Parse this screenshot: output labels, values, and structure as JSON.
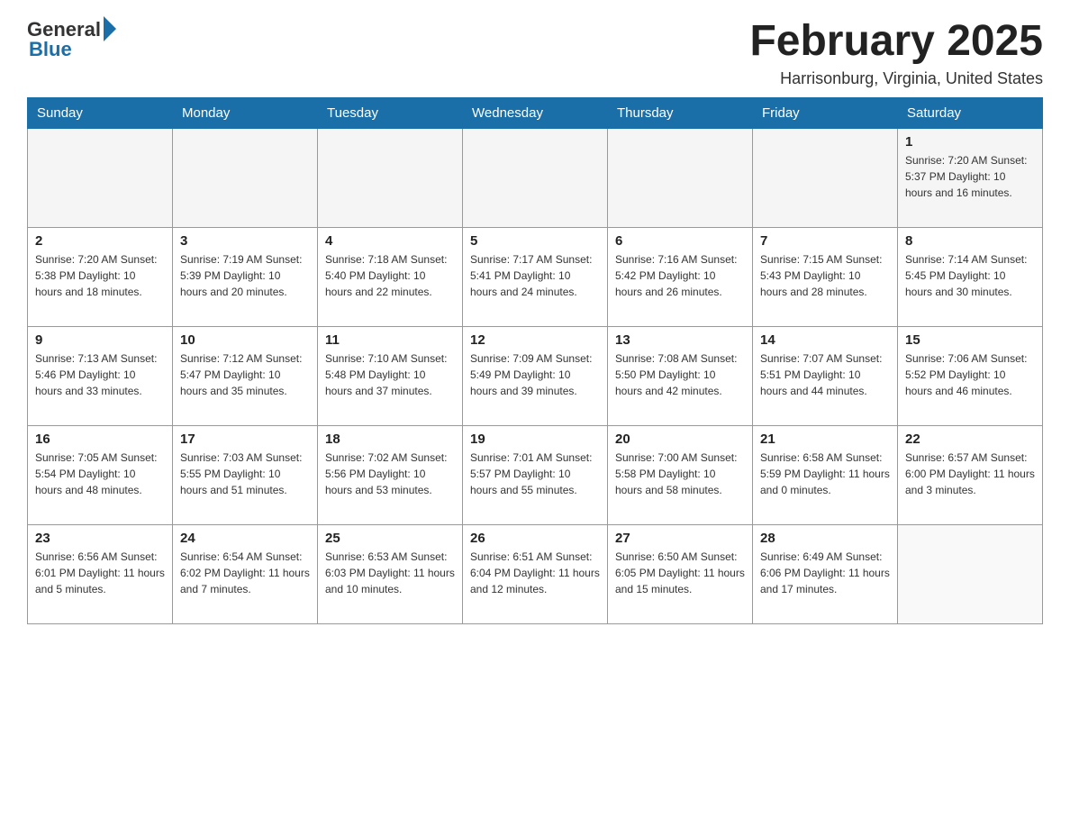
{
  "header": {
    "logo_general": "General",
    "logo_blue": "Blue",
    "month_title": "February 2025",
    "location": "Harrisonburg, Virginia, United States"
  },
  "days_of_week": [
    "Sunday",
    "Monday",
    "Tuesday",
    "Wednesday",
    "Thursday",
    "Friday",
    "Saturday"
  ],
  "weeks": [
    [
      {
        "day": "",
        "info": ""
      },
      {
        "day": "",
        "info": ""
      },
      {
        "day": "",
        "info": ""
      },
      {
        "day": "",
        "info": ""
      },
      {
        "day": "",
        "info": ""
      },
      {
        "day": "",
        "info": ""
      },
      {
        "day": "1",
        "info": "Sunrise: 7:20 AM\nSunset: 5:37 PM\nDaylight: 10 hours and 16 minutes."
      }
    ],
    [
      {
        "day": "2",
        "info": "Sunrise: 7:20 AM\nSunset: 5:38 PM\nDaylight: 10 hours and 18 minutes."
      },
      {
        "day": "3",
        "info": "Sunrise: 7:19 AM\nSunset: 5:39 PM\nDaylight: 10 hours and 20 minutes."
      },
      {
        "day": "4",
        "info": "Sunrise: 7:18 AM\nSunset: 5:40 PM\nDaylight: 10 hours and 22 minutes."
      },
      {
        "day": "5",
        "info": "Sunrise: 7:17 AM\nSunset: 5:41 PM\nDaylight: 10 hours and 24 minutes."
      },
      {
        "day": "6",
        "info": "Sunrise: 7:16 AM\nSunset: 5:42 PM\nDaylight: 10 hours and 26 minutes."
      },
      {
        "day": "7",
        "info": "Sunrise: 7:15 AM\nSunset: 5:43 PM\nDaylight: 10 hours and 28 minutes."
      },
      {
        "day": "8",
        "info": "Sunrise: 7:14 AM\nSunset: 5:45 PM\nDaylight: 10 hours and 30 minutes."
      }
    ],
    [
      {
        "day": "9",
        "info": "Sunrise: 7:13 AM\nSunset: 5:46 PM\nDaylight: 10 hours and 33 minutes."
      },
      {
        "day": "10",
        "info": "Sunrise: 7:12 AM\nSunset: 5:47 PM\nDaylight: 10 hours and 35 minutes."
      },
      {
        "day": "11",
        "info": "Sunrise: 7:10 AM\nSunset: 5:48 PM\nDaylight: 10 hours and 37 minutes."
      },
      {
        "day": "12",
        "info": "Sunrise: 7:09 AM\nSunset: 5:49 PM\nDaylight: 10 hours and 39 minutes."
      },
      {
        "day": "13",
        "info": "Sunrise: 7:08 AM\nSunset: 5:50 PM\nDaylight: 10 hours and 42 minutes."
      },
      {
        "day": "14",
        "info": "Sunrise: 7:07 AM\nSunset: 5:51 PM\nDaylight: 10 hours and 44 minutes."
      },
      {
        "day": "15",
        "info": "Sunrise: 7:06 AM\nSunset: 5:52 PM\nDaylight: 10 hours and 46 minutes."
      }
    ],
    [
      {
        "day": "16",
        "info": "Sunrise: 7:05 AM\nSunset: 5:54 PM\nDaylight: 10 hours and 48 minutes."
      },
      {
        "day": "17",
        "info": "Sunrise: 7:03 AM\nSunset: 5:55 PM\nDaylight: 10 hours and 51 minutes."
      },
      {
        "day": "18",
        "info": "Sunrise: 7:02 AM\nSunset: 5:56 PM\nDaylight: 10 hours and 53 minutes."
      },
      {
        "day": "19",
        "info": "Sunrise: 7:01 AM\nSunset: 5:57 PM\nDaylight: 10 hours and 55 minutes."
      },
      {
        "day": "20",
        "info": "Sunrise: 7:00 AM\nSunset: 5:58 PM\nDaylight: 10 hours and 58 minutes."
      },
      {
        "day": "21",
        "info": "Sunrise: 6:58 AM\nSunset: 5:59 PM\nDaylight: 11 hours and 0 minutes."
      },
      {
        "day": "22",
        "info": "Sunrise: 6:57 AM\nSunset: 6:00 PM\nDaylight: 11 hours and 3 minutes."
      }
    ],
    [
      {
        "day": "23",
        "info": "Sunrise: 6:56 AM\nSunset: 6:01 PM\nDaylight: 11 hours and 5 minutes."
      },
      {
        "day": "24",
        "info": "Sunrise: 6:54 AM\nSunset: 6:02 PM\nDaylight: 11 hours and 7 minutes."
      },
      {
        "day": "25",
        "info": "Sunrise: 6:53 AM\nSunset: 6:03 PM\nDaylight: 11 hours and 10 minutes."
      },
      {
        "day": "26",
        "info": "Sunrise: 6:51 AM\nSunset: 6:04 PM\nDaylight: 11 hours and 12 minutes."
      },
      {
        "day": "27",
        "info": "Sunrise: 6:50 AM\nSunset: 6:05 PM\nDaylight: 11 hours and 15 minutes."
      },
      {
        "day": "28",
        "info": "Sunrise: 6:49 AM\nSunset: 6:06 PM\nDaylight: 11 hours and 17 minutes."
      },
      {
        "day": "",
        "info": ""
      }
    ]
  ]
}
